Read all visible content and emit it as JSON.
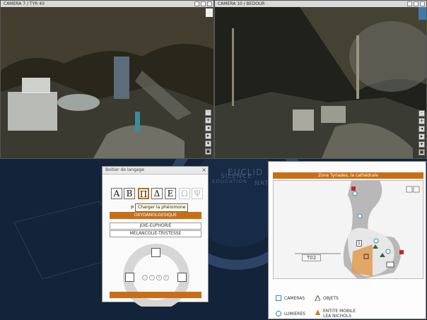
{
  "cameras": {
    "left": {
      "title": "CAMERA 7 / TYR 40"
    },
    "right": {
      "title": "CAMERA 10 / BEDOUR"
    }
  },
  "side_buttons": [
    "-",
    "+",
    "◂",
    "▸",
    "▾",
    "▣"
  ],
  "background_marks": [
    "EUCLID",
    "SILENCE",
    "NATURAM",
    "EDUCATION"
  ],
  "language_panel": {
    "title": "Boitier de langage",
    "glyphs": [
      "A",
      "B",
      "Π",
      "Δ",
      "E",
      "Ω",
      "Ψ"
    ],
    "tooltip": "Charger la phéromone",
    "emotions": [
      {
        "label": "OXYDANOLGESIQUE",
        "selected": true
      },
      {
        "label": "JOIE-EUPHORIE",
        "selected": false
      },
      {
        "label": "MELANCOLIE-TRISTESSE",
        "selected": false
      }
    ],
    "small_letter": "P",
    "orb_labels": [
      "○",
      "i",
      "ii",
      "o"
    ]
  },
  "map_panel": {
    "zone_title": "Zone Tyriades, la cathédrale",
    "sector_label": "T02",
    "marker_number": "1",
    "legend": {
      "cameras": "CAMERAS",
      "objets": "OBJETS",
      "lumieres": "LUMIERES",
      "entite": "ENTITE MOBILE",
      "entite_name": "LEA NICHOLS"
    },
    "colors": {
      "accent": "#c86e16",
      "camera_icon": "#2f8fa8",
      "object_icon": "#2d6a3a",
      "entity_icon": "#d87a1c"
    }
  }
}
